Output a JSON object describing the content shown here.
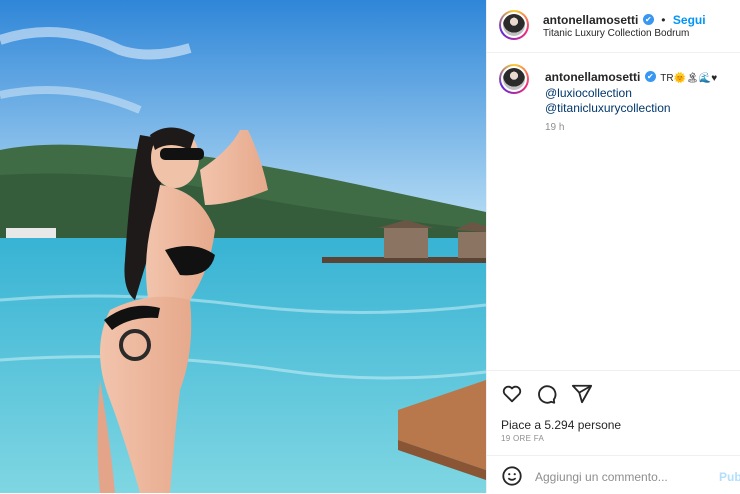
{
  "post": {
    "username": "antonellamosetti",
    "verified_badge": "✔",
    "follow_separator": "•",
    "follow_label": "Segui",
    "location": "Titanic Luxury Collection Bodrum"
  },
  "caption": {
    "username": "antonellamosetti",
    "emojis": "TR🌞🏝🌊♥",
    "mentions": [
      "@luxiocollection",
      "@titanicluxurycollection"
    ],
    "time": "19 h"
  },
  "stats": {
    "likes_label": "Piace a 5.294 persone",
    "posted_ago": "19 ORE FA"
  },
  "comment_box": {
    "placeholder": "Aggiungi un commento...",
    "publish_label": "Pub"
  },
  "icons": {
    "like": "heart-icon",
    "comment": "comment-icon",
    "share": "share-icon",
    "emoji": "emoji-icon"
  }
}
